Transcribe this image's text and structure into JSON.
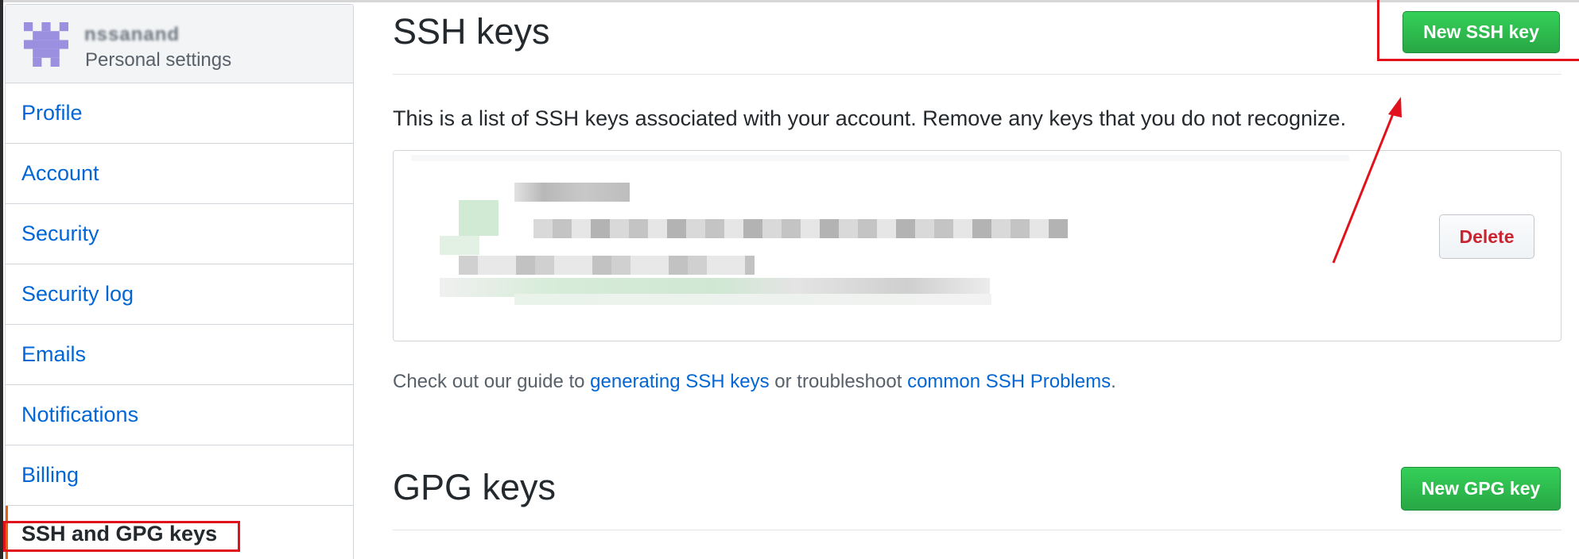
{
  "sidebar": {
    "user_name": "nssanand",
    "subtitle": "Personal settings",
    "items": [
      {
        "label": "Profile"
      },
      {
        "label": "Account"
      },
      {
        "label": "Security"
      },
      {
        "label": "Security log"
      },
      {
        "label": "Emails"
      },
      {
        "label": "Notifications"
      },
      {
        "label": "Billing"
      },
      {
        "label": "SSH and GPG keys",
        "selected": true
      }
    ]
  },
  "ssh": {
    "title": "SSH keys",
    "new_button": "New SSH key",
    "description": "This is a list of SSH keys associated with your account. Remove any keys that you do not recognize.",
    "delete_button": "Delete"
  },
  "guide": {
    "prefix": "Check out our guide to ",
    "link1": "generating SSH keys",
    "middle": " or troubleshoot ",
    "link2": "common SSH Problems",
    "suffix": "."
  },
  "gpg": {
    "title": "GPG keys",
    "new_button": "New GPG key"
  },
  "colors": {
    "link": "#0366d6",
    "green_button": "#28a745",
    "danger": "#cb2431",
    "annotation": "#e1121b",
    "avatar": "#9b8fe0"
  },
  "icons": {
    "avatar": "identicon-avatar",
    "arrow": "annotation-arrow"
  }
}
